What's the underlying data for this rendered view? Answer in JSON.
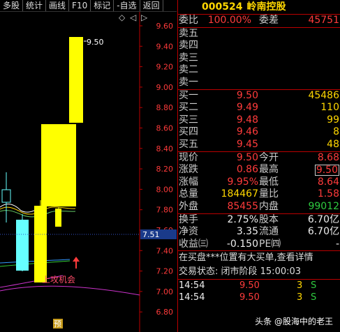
{
  "toolbar": {
    "items": [
      "多股",
      "统计",
      "画线",
      "F10",
      "标记",
      "-自选",
      "返回"
    ]
  },
  "chart": {
    "controls": {
      "diamond": "◇",
      "left_arrow": "◁",
      "right_arrow": "▷"
    },
    "price_labels": [
      "9.60",
      "9.40",
      "9.20",
      "9.00",
      "8.80",
      "8.60",
      "8.40",
      "8.20",
      "8.00",
      "7.80",
      "7.60",
      "7.40",
      "7.20",
      "7.00",
      "6.80"
    ],
    "current_price_tag": "7.51",
    "peak_label": "9.50",
    "signal_text": "上攻机会",
    "pre_badge": "预",
    "colors": {
      "up": "#ffff00",
      "down": "#66ffff",
      "label": "#ff3b3b",
      "signal": "#ff4d6a"
    }
  },
  "panel": {
    "code": "000524",
    "name": "岭南控股",
    "weibi": {
      "label": "委比",
      "value": "100.00%",
      "label2": "委差",
      "value2": "45751"
    },
    "sells": [
      {
        "label": "卖五",
        "price": "",
        "vol": ""
      },
      {
        "label": "卖四",
        "price": "",
        "vol": ""
      },
      {
        "label": "卖三",
        "price": "",
        "vol": ""
      },
      {
        "label": "卖二",
        "price": "",
        "vol": ""
      },
      {
        "label": "卖一",
        "price": "",
        "vol": ""
      }
    ],
    "buys": [
      {
        "label": "买一",
        "price": "9.50",
        "vol": "45486"
      },
      {
        "label": "买二",
        "price": "9.49",
        "vol": "110"
      },
      {
        "label": "买三",
        "price": "9.48",
        "vol": "99"
      },
      {
        "label": "买四",
        "price": "9.46",
        "vol": "8"
      },
      {
        "label": "买五",
        "price": "9.45",
        "vol": "48"
      }
    ],
    "stats": [
      {
        "l1": "现价",
        "v1": "9.50",
        "c1": "red",
        "l2": "今开",
        "v2": "8.68",
        "c2": "red"
      },
      {
        "l1": "涨跌",
        "v1": "0.86",
        "c1": "red",
        "l2": "最高",
        "v2": "9.50",
        "c2": "red boxed"
      },
      {
        "l1": "涨幅",
        "v1": "9.95%",
        "c1": "red",
        "l2": "最低",
        "v2": "8.64",
        "c2": "red"
      },
      {
        "l1": "总量",
        "v1": "184467",
        "c1": "yellow",
        "l2": "量比",
        "v2": "1.58",
        "c2": "red"
      },
      {
        "l1": "外盘",
        "v1": "85455",
        "c1": "red",
        "l2": "内盘",
        "v2": "99012",
        "c2": "green"
      }
    ],
    "stats2": [
      {
        "l1": "换手",
        "v1": "2.75%",
        "c1": "white",
        "l2": "股本",
        "v2": "6.70亿",
        "c2": "white"
      },
      {
        "l1": "净资",
        "v1": "3.35",
        "c1": "white",
        "l2": "流通",
        "v2": "6.70亿",
        "c2": "white"
      },
      {
        "l1": "收益㈢",
        "v1": "-0.150",
        "c1": "white",
        "l2": "PE㈣",
        "v2": "-",
        "c2": "white"
      }
    ],
    "message": "在买盘***位置有大买单,查看详情",
    "status": "交易状态: 闭市阶段 15:00:03",
    "ticks": [
      {
        "time": "14:54",
        "price": "9.50",
        "vol": "3",
        "flag": "S"
      },
      {
        "time": "14:54",
        "price": "9.50",
        "vol": "3",
        "flag": "S"
      }
    ]
  },
  "watermark": "头条 @股海中的老王"
}
